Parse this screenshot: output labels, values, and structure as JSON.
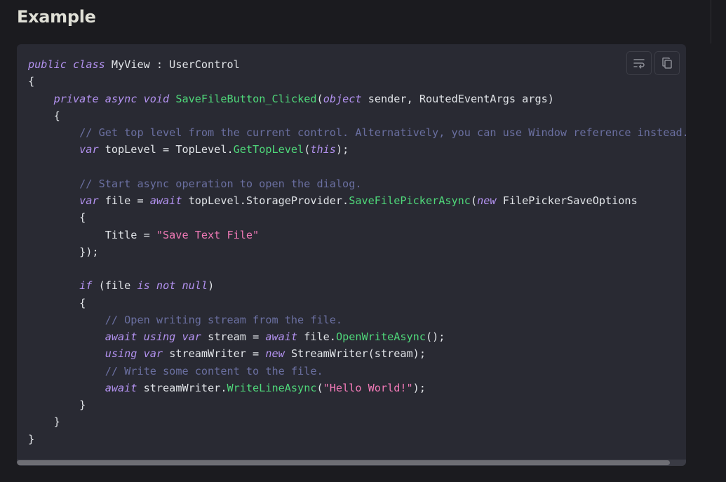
{
  "heading": "Example",
  "code_block": {
    "language": "csharp",
    "toolbar": {
      "wrap_icon": "text-wrap-icon",
      "copy_icon": "copy-icon"
    },
    "scroll_position": 0.0,
    "scroll_visible_fraction": 0.976,
    "lines": [
      [
        [
          "kw",
          "public"
        ],
        [
          "pl",
          " "
        ],
        [
          "kw",
          "class"
        ],
        [
          "pl",
          " MyView : UserControl"
        ]
      ],
      [
        [
          "pl",
          "{"
        ]
      ],
      [
        [
          "pl",
          "    "
        ],
        [
          "kw",
          "private"
        ],
        [
          "pl",
          " "
        ],
        [
          "kw",
          "async"
        ],
        [
          "pl",
          " "
        ],
        [
          "kw",
          "void"
        ],
        [
          "pl",
          " "
        ],
        [
          "fn",
          "SaveFileButton_Clicked"
        ],
        [
          "pl",
          "("
        ],
        [
          "kw",
          "object"
        ],
        [
          "pl",
          " sender, RoutedEventArgs args)"
        ]
      ],
      [
        [
          "pl",
          "    {"
        ]
      ],
      [
        [
          "pl",
          "        "
        ],
        [
          "cm",
          "// Get top level from the current control. Alternatively, you can use Window reference instead."
        ]
      ],
      [
        [
          "pl",
          "        "
        ],
        [
          "kw",
          "var"
        ],
        [
          "pl",
          " topLevel = TopLevel."
        ],
        [
          "fn",
          "GetTopLevel"
        ],
        [
          "pl",
          "("
        ],
        [
          "kw",
          "this"
        ],
        [
          "pl",
          ");"
        ]
      ],
      [
        [
          "pl",
          ""
        ]
      ],
      [
        [
          "pl",
          "        "
        ],
        [
          "cm",
          "// Start async operation to open the dialog."
        ]
      ],
      [
        [
          "pl",
          "        "
        ],
        [
          "kw",
          "var"
        ],
        [
          "pl",
          " file = "
        ],
        [
          "kw",
          "await"
        ],
        [
          "pl",
          " topLevel.StorageProvider."
        ],
        [
          "fn",
          "SaveFilePickerAsync"
        ],
        [
          "pl",
          "("
        ],
        [
          "kw",
          "new"
        ],
        [
          "pl",
          " FilePickerSaveOptions"
        ]
      ],
      [
        [
          "pl",
          "        {"
        ]
      ],
      [
        [
          "pl",
          "            Title = "
        ],
        [
          "str",
          "\"Save Text File\""
        ]
      ],
      [
        [
          "pl",
          "        });"
        ]
      ],
      [
        [
          "pl",
          ""
        ]
      ],
      [
        [
          "pl",
          "        "
        ],
        [
          "kw",
          "if"
        ],
        [
          "pl",
          " (file "
        ],
        [
          "kw",
          "is"
        ],
        [
          "pl",
          " "
        ],
        [
          "kw",
          "not"
        ],
        [
          "pl",
          " "
        ],
        [
          "kw",
          "null"
        ],
        [
          "pl",
          ")"
        ]
      ],
      [
        [
          "pl",
          "        {"
        ]
      ],
      [
        [
          "pl",
          "            "
        ],
        [
          "cm",
          "// Open writing stream from the file."
        ]
      ],
      [
        [
          "pl",
          "            "
        ],
        [
          "kw",
          "await"
        ],
        [
          "pl",
          " "
        ],
        [
          "kw",
          "using"
        ],
        [
          "pl",
          " "
        ],
        [
          "kw",
          "var"
        ],
        [
          "pl",
          " stream = "
        ],
        [
          "kw",
          "await"
        ],
        [
          "pl",
          " file."
        ],
        [
          "fn",
          "OpenWriteAsync"
        ],
        [
          "pl",
          "();"
        ]
      ],
      [
        [
          "pl",
          "            "
        ],
        [
          "kw",
          "using"
        ],
        [
          "pl",
          " "
        ],
        [
          "kw",
          "var"
        ],
        [
          "pl",
          " streamWriter = "
        ],
        [
          "kw",
          "new"
        ],
        [
          "pl",
          " StreamWriter(stream);"
        ]
      ],
      [
        [
          "pl",
          "            "
        ],
        [
          "cm",
          "// Write some content to the file."
        ]
      ],
      [
        [
          "pl",
          "            "
        ],
        [
          "kw",
          "await"
        ],
        [
          "pl",
          " streamWriter."
        ],
        [
          "fn",
          "WriteLineAsync"
        ],
        [
          "pl",
          "("
        ],
        [
          "str",
          "\"Hello World!\""
        ],
        [
          "pl",
          ");"
        ]
      ],
      [
        [
          "pl",
          "        }"
        ]
      ],
      [
        [
          "pl",
          "    }"
        ]
      ],
      [
        [
          "pl",
          "}"
        ]
      ]
    ]
  },
  "colors": {
    "page_bg": "#1b1b1f",
    "code_bg": "#292a33",
    "keyword": "#b392f0",
    "function": "#4fd87a",
    "string": "#f27ab8",
    "comment": "#6a6fa0",
    "plain": "#e1e4e8"
  }
}
